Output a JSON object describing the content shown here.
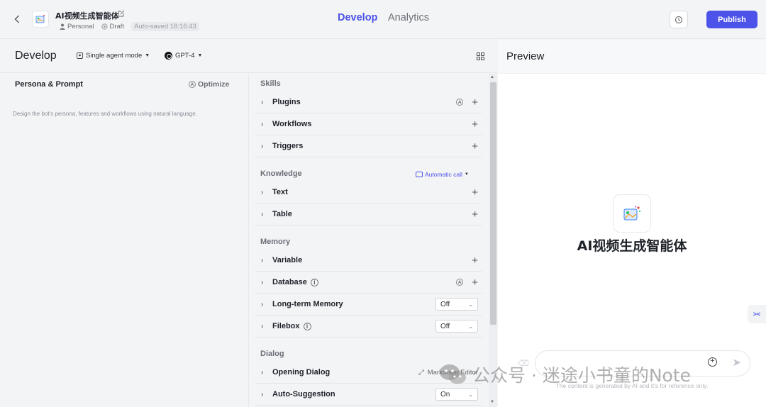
{
  "header": {
    "bot_name": "AI视频生成智能体",
    "owner": "Personal",
    "status": "Draft",
    "autosave": "Auto-saved 18:16:43",
    "tabs": [
      {
        "label": "Develop"
      },
      {
        "label": "Analytics"
      }
    ],
    "publish_label": "Publish"
  },
  "toolbar": {
    "title": "Develop",
    "mode": "Single agent mode",
    "model": "GPT-4"
  },
  "persona": {
    "title": "Persona & Prompt",
    "optimize_label": "Optimize",
    "placeholder": "Design the bot's persona, features and workflows using natural language."
  },
  "skills": {
    "section_skills": "Skills",
    "plugins": "Plugins",
    "workflows": "Workflows",
    "triggers": "Triggers",
    "section_knowledge": "Knowledge",
    "automatic_call": "Automatic call",
    "text": "Text",
    "table": "Table",
    "section_memory": "Memory",
    "variable": "Variable",
    "database": "Database",
    "long_term_memory": "Long-term Memory",
    "long_term_value": "Off",
    "filebox": "Filebox",
    "filebox_value": "Off",
    "section_dialog": "Dialog",
    "opening_dialog": "Opening Dialog",
    "markdown_editor": "Markdown Editor",
    "auto_suggestion": "Auto-Suggestion",
    "auto_suggestion_value": "On"
  },
  "preview": {
    "title": "Preview",
    "bot_name": "AI视频生成智能体",
    "disclaimer": "The content is generated by AI and it's for reference only."
  },
  "watermark": "公众号 · 迷途小书童的Note",
  "colors": {
    "accent": "#4d53e8",
    "background": "#f3f4f6"
  }
}
